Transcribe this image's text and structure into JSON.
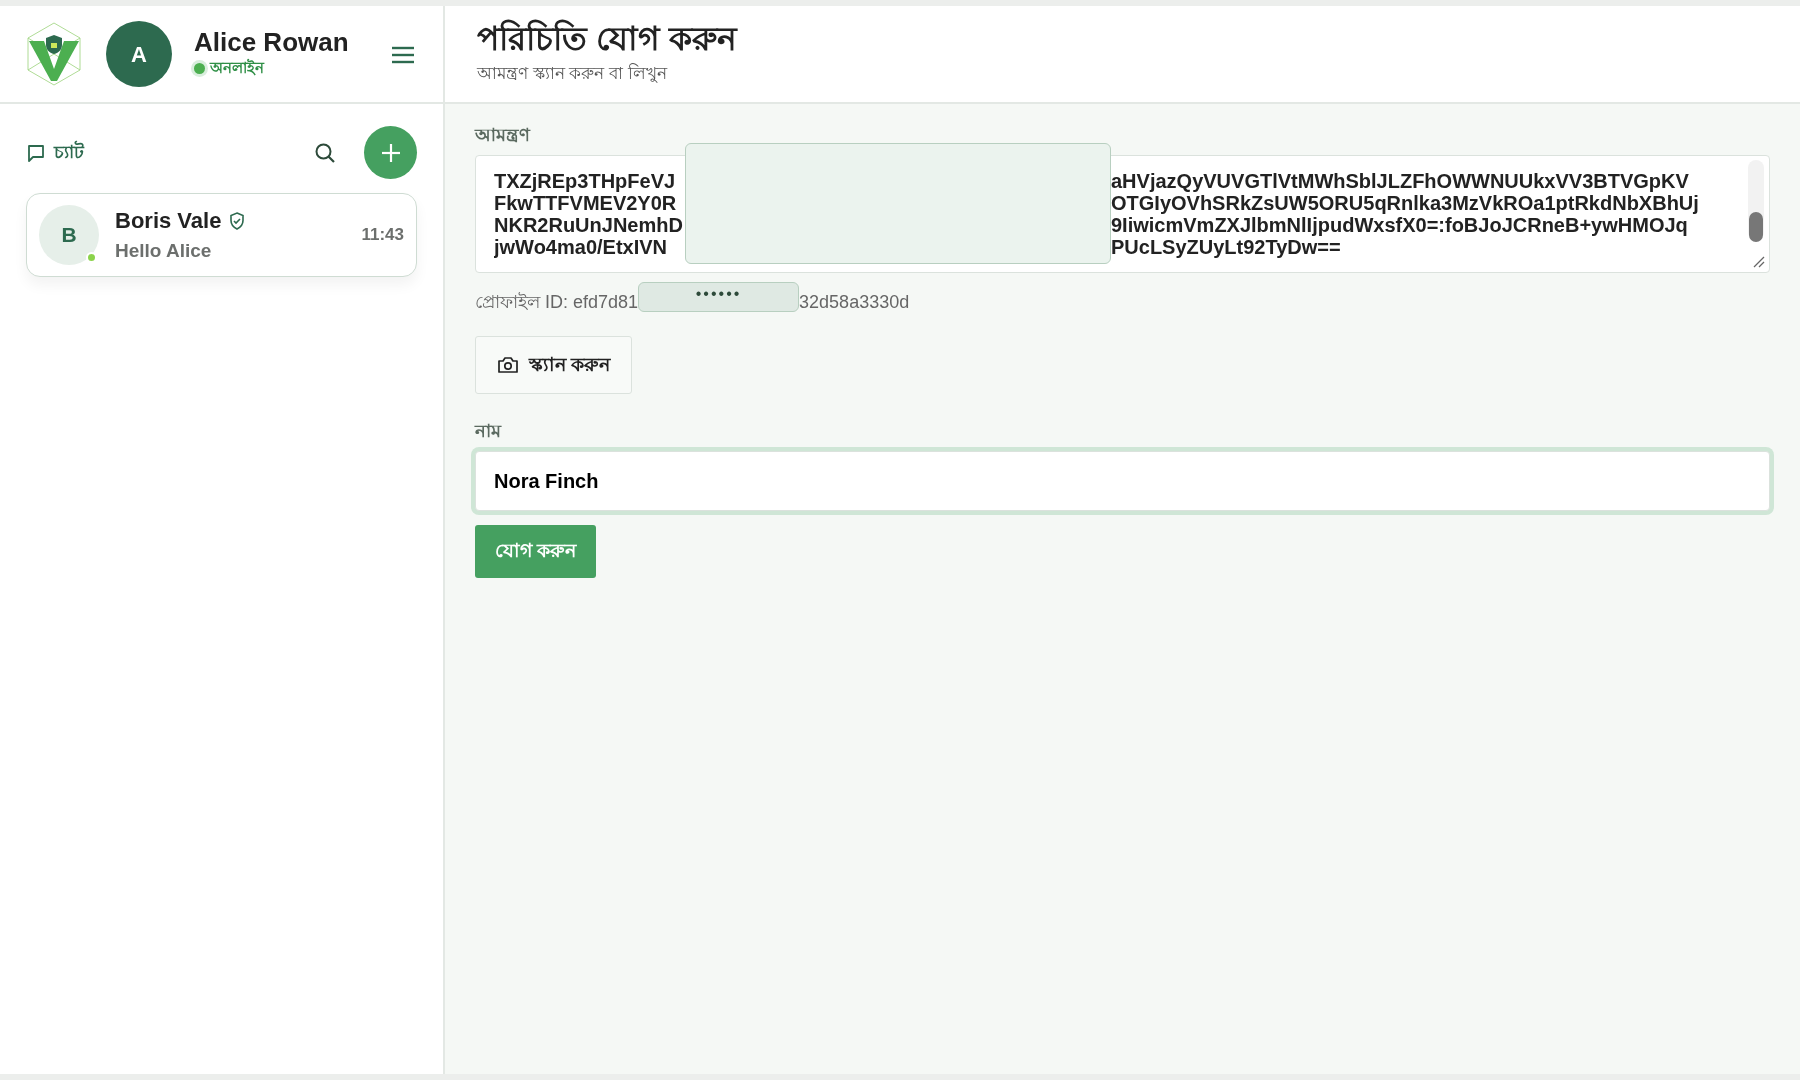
{
  "sidebar": {
    "user": {
      "avatar_letter": "A",
      "name": "Alice Rowan",
      "status": "অনলাইন",
      "online": true
    },
    "section_title": "চ্যাট",
    "chats": [
      {
        "avatar_letter": "B",
        "name": "Boris Vale",
        "verified": true,
        "online": true,
        "preview": "Hello Alice",
        "time": "11:43"
      }
    ]
  },
  "main": {
    "title": "পরিচিতি যোগ করুন",
    "subtitle": "আমন্ত্রণ স্ক্যান করুন বা লিখুন",
    "invite": {
      "label": "আমন্ত্রণ",
      "masked": true,
      "lines": [
        {
          "left": "TXZjREp3THpFeVJ",
          "right": "aHVjazQyVUVGTlVtMWhSblJLZFhOWWNUUkxVV3BTVGpKV"
        },
        {
          "left": "FkwTTFVMEV2Y0R",
          "right": "OTGIyOVhSRkZsUW5ORU5qRnlka3MzVkROa1ptRkdNbXBhUj"
        },
        {
          "left": "NKR2RuUnJNemhD",
          "right": "9IiwicmVmZXJlbmNlIjpudWxsfX0=:foBJoJCRneB+ywHMOJq"
        },
        {
          "left": "jwWo4ma0/EtxIVN",
          "right": "PUcLSyZUyLt92TyDw=="
        }
      ]
    },
    "profile_id": {
      "prefix": "প্রোফাইল ID: efd7d81",
      "mask": "••••••",
      "suffix": "32d58a3330d"
    },
    "scan_button": "স্ক্যান করুন",
    "name_field": {
      "label": "নাম",
      "value": "Nora Finch",
      "focused": true
    },
    "submit_button": "যোগ করুন"
  }
}
